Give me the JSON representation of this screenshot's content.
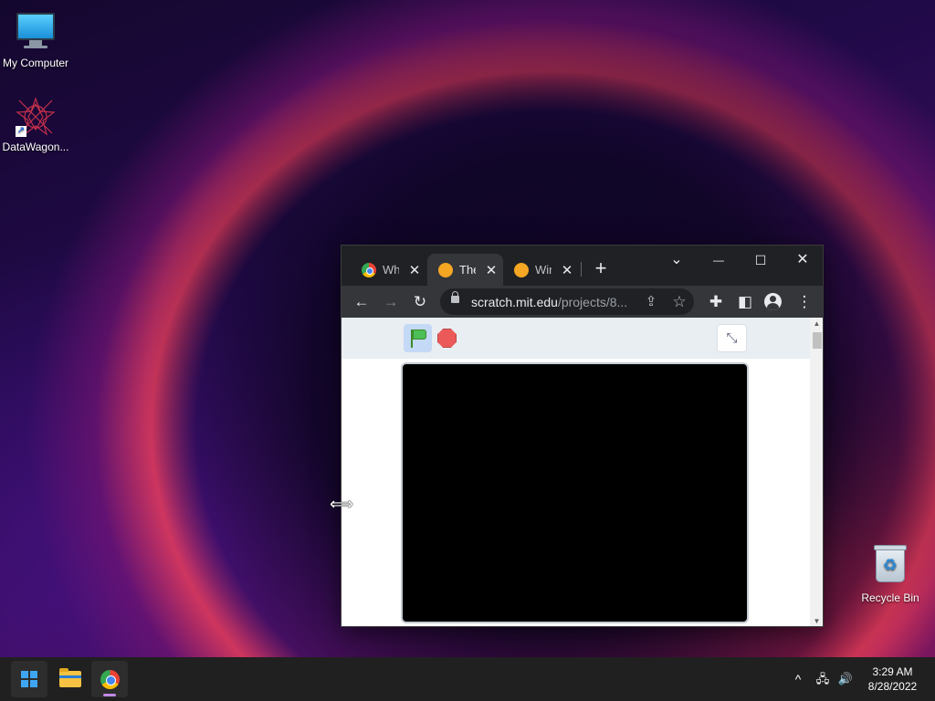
{
  "desktop": {
    "icons": [
      {
        "label": "My Computer",
        "icon": "monitor-icon"
      },
      {
        "label": "DataWagon...",
        "icon": "datawagon-icon"
      },
      {
        "label": "Recycle Bin",
        "icon": "recycle-bin-icon"
      }
    ]
  },
  "browser": {
    "tabs": [
      {
        "title": "What",
        "favicon": "chrome-favicon-icon",
        "active": false
      },
      {
        "title": "The",
        "favicon": "scratch-favicon-icon",
        "active": true
      },
      {
        "title": "Win",
        "favicon": "scratch-favicon-icon",
        "active": false
      }
    ],
    "tab_close_glyph": "✕",
    "new_tab_glyph": "+",
    "window_controls": {
      "tab_search": "⌄",
      "minimize": "—",
      "maximize": "☐",
      "close": "✕"
    },
    "toolbar": {
      "back": "←",
      "forward": "→",
      "reload": "↻",
      "url_host": "scratch.mit.edu",
      "url_path": "/projects/8...",
      "share": "⇪",
      "bookmark": "☆",
      "extensions": "✚",
      "side_panel": "◧",
      "menu": "⋮"
    },
    "scratch_player": {
      "fullscreen_glyph": "⤡",
      "stage_color": "#000000"
    }
  },
  "taskbar": {
    "tray": {
      "chevron": "^",
      "network": "🖧",
      "volume": "🔊"
    },
    "clock": {
      "time": "3:29 AM",
      "date": "8/28/2022"
    }
  },
  "colors": {
    "taskbar_bg": "#202020",
    "browser_frame": "#202124",
    "browser_toolbar": "#35363a",
    "scratch_menu_bg": "#e9eef2",
    "flag_green": "#4cbf56",
    "stop_red": "#ec5959"
  }
}
